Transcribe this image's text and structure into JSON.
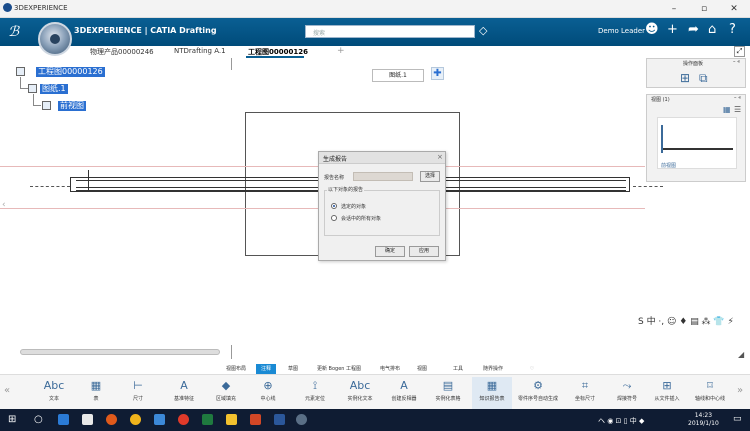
{
  "window": {
    "title": "3DEXPERIENCE",
    "min": "–",
    "max": "▫",
    "close": "✕"
  },
  "topbar": {
    "ds_logo": "ℬ",
    "brand": "3DEXPERIENCE | CATIA Drafting",
    "search_placeholder": "搜索",
    "user": "Demo Leader",
    "icons": [
      "user-icon",
      "plus-icon",
      "share-icon",
      "home-icon",
      "help-icon"
    ]
  },
  "tabs": [
    {
      "label": "物理产品00000246"
    },
    {
      "label": "NTDrafting A.1"
    },
    {
      "label": "工程图00000126"
    }
  ],
  "tab_add": "+",
  "tree": {
    "root": "工程图00000126",
    "child": "图纸.1",
    "grandchild": "前视图"
  },
  "sheet_tag": "图纸.1",
  "dialog": {
    "title": "生成报告",
    "file_label": "报告名称",
    "select_button": "选择",
    "group_label": "以下对象的报告",
    "option1": "选定的对象",
    "option2": "会话中的所有对象",
    "ok": "确定",
    "apply": "应用"
  },
  "right_panel": {
    "ops_title": "操作面板",
    "views_title": "视图 (1)",
    "view_label": "前视图"
  },
  "command_tabs": [
    "视图布局",
    "注释",
    "草图",
    "更新 Bogen 工程图",
    "电气排布",
    "视图",
    "工具",
    "随界操作"
  ],
  "active_command_tab": "注释",
  "tools": [
    {
      "icon": "Abc",
      "label": "文本"
    },
    {
      "icon": "▦",
      "label": "表"
    },
    {
      "icon": "⊢",
      "label": "尺寸"
    },
    {
      "icon": "A",
      "label": "基准特征"
    },
    {
      "icon": "◆",
      "label": "区域填充"
    },
    {
      "icon": "⊕",
      "label": "中心线"
    },
    {
      "icon": "⟟",
      "label": "元素定位"
    },
    {
      "icon": "Abc",
      "label": "实例化文本"
    },
    {
      "icon": "A",
      "label": "创建反相器"
    },
    {
      "icon": "▤",
      "label": "实例化表格"
    },
    {
      "icon": "▦",
      "label": "知识报告表"
    },
    {
      "icon": "⚙",
      "label": "零件序号自动生成"
    },
    {
      "icon": "⌗",
      "label": "坐标尺寸"
    },
    {
      "icon": "⤳",
      "label": "焊接符号"
    },
    {
      "icon": "⊞",
      "label": "从文件插入"
    },
    {
      "icon": "⌑",
      "label": "轴线和中心线"
    }
  ],
  "taskbar": {
    "time": "14:23",
    "date": "2019/1/10",
    "tray": "ヘ ◉ ⊡ ▯ 中 ◆"
  },
  "sogou": "S 中 ·, ☺ ♦ ▤ ⁂ 👕 ⚡"
}
